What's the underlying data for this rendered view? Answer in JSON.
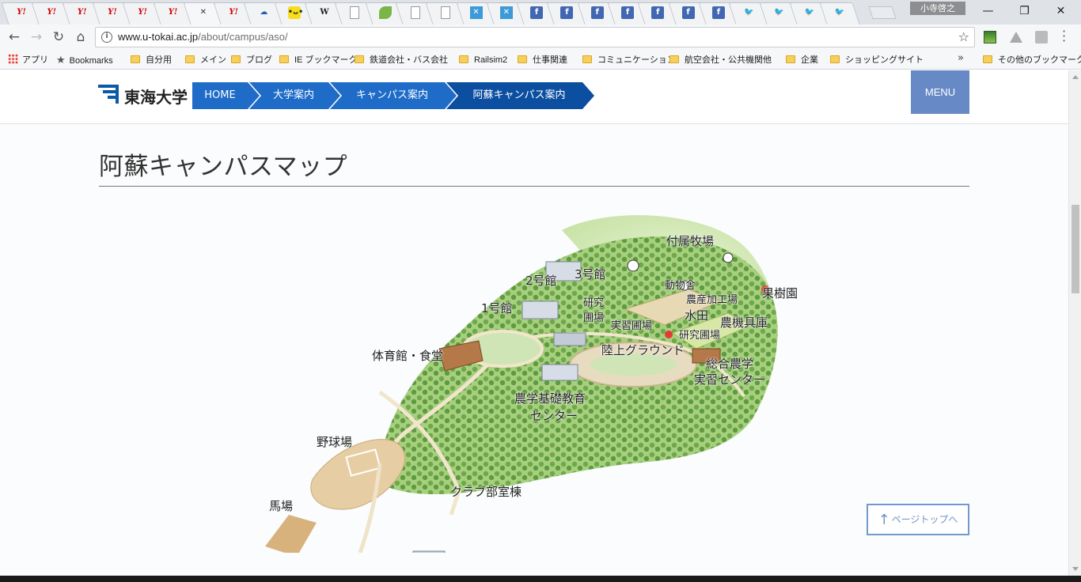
{
  "browser": {
    "tabs": [
      {
        "icon": "yahoo-icon",
        "glyph": "Y!"
      },
      {
        "icon": "yahoo-icon",
        "glyph": "Y!"
      },
      {
        "icon": "yahoo-icon",
        "glyph": "Y!"
      },
      {
        "icon": "yahoo-icon",
        "glyph": "Y!"
      },
      {
        "icon": "yahoo-icon",
        "glyph": "Y!"
      },
      {
        "icon": "yahoo-icon",
        "glyph": "Y!"
      },
      {
        "icon": "close-icon",
        "glyph": "✕",
        "active": true
      },
      {
        "icon": "yahoo-icon",
        "glyph": "Y!"
      },
      {
        "icon": "onedrive-icon",
        "glyph": "☁"
      },
      {
        "icon": "face-icon",
        "glyph": "•ᴗ•"
      },
      {
        "icon": "wikipedia-icon",
        "glyph": "W"
      },
      {
        "icon": "document-icon",
        "glyph": ""
      },
      {
        "icon": "leaf-icon",
        "glyph": ""
      },
      {
        "icon": "document-icon",
        "glyph": ""
      },
      {
        "icon": "document-icon",
        "glyph": ""
      },
      {
        "icon": "x-icon",
        "glyph": "✕"
      },
      {
        "icon": "x-icon",
        "glyph": "✕"
      },
      {
        "icon": "facebook-icon",
        "glyph": "f"
      },
      {
        "icon": "facebook-icon",
        "glyph": "f"
      },
      {
        "icon": "facebook-icon",
        "glyph": "f"
      },
      {
        "icon": "facebook-icon",
        "glyph": "f"
      },
      {
        "icon": "facebook-icon",
        "glyph": "f"
      },
      {
        "icon": "facebook-icon",
        "glyph": "f"
      },
      {
        "icon": "facebook-icon",
        "glyph": "f"
      },
      {
        "icon": "twitter-icon",
        "glyph": "🐦"
      },
      {
        "icon": "twitter-icon",
        "glyph": "🐦"
      },
      {
        "icon": "twitter-icon",
        "glyph": "🐦"
      },
      {
        "icon": "twitter-icon",
        "glyph": "🐦"
      }
    ],
    "profile_name": "小寺啓之",
    "window_controls": {
      "minimize": "—",
      "restore": "❐",
      "close": "✕"
    },
    "url_domain": "www.u-tokai.ac.jp",
    "url_path": "/about/campus/aso/",
    "nav": {
      "back": "←",
      "forward": "→",
      "reload": "↻",
      "home": "⌂"
    },
    "bookmarks": [
      {
        "label": "アプリ",
        "kind": "apps"
      },
      {
        "label": "Bookmarks",
        "kind": "star"
      },
      {
        "label": "自分用",
        "kind": "folder"
      },
      {
        "label": "メイン",
        "kind": "folder"
      },
      {
        "label": "ブログ",
        "kind": "folder"
      },
      {
        "label": "IE ブックマーク",
        "kind": "folder"
      },
      {
        "label": "鉄道会社・バス会社",
        "kind": "folder"
      },
      {
        "label": "Railsim2",
        "kind": "folder"
      },
      {
        "label": "仕事関連",
        "kind": "folder"
      },
      {
        "label": "コミュニケーション",
        "kind": "folder"
      },
      {
        "label": "航空会社・公共機関他",
        "kind": "folder"
      },
      {
        "label": "企業",
        "kind": "folder"
      },
      {
        "label": "ショッピングサイト",
        "kind": "folder"
      }
    ],
    "bookmarks_more": "»",
    "other_bookmarks": "その他のブックマーク"
  },
  "site": {
    "logo_text": "東海大学",
    "breadcrumb": [
      "HOME",
      "大学案内",
      "キャンパス案内",
      "阿蘇キャンパス案内"
    ],
    "menu_label": "MENU",
    "page_title": "阿蘇キャンパスマップ",
    "pagetop_label": "ページトップへ",
    "pagetop_arrow": "↑"
  },
  "map": {
    "labels": {
      "farm": "付属牧場",
      "bldg2": "2号館",
      "bldg3": "3号館",
      "animal_house": "動物舎",
      "processing": "農産加工場",
      "orchard": "果樹園",
      "bldg1": "1号館",
      "research_field_a": "研究",
      "research_field_b": "圃場",
      "practice_field": "実習圃場",
      "paddy": "水田",
      "machinery": "農機具庫",
      "research_field2": "研究圃場",
      "gym": "体育館・食堂",
      "track": "陸上グラウンド",
      "agri_center_a": "総合農学",
      "agri_center_b": "実習センター",
      "edu_center_a": "農学基礎教育",
      "edu_center_b": "センター",
      "baseball": "野球場",
      "club": "クラブ部室棟",
      "horse": "馬場"
    }
  }
}
